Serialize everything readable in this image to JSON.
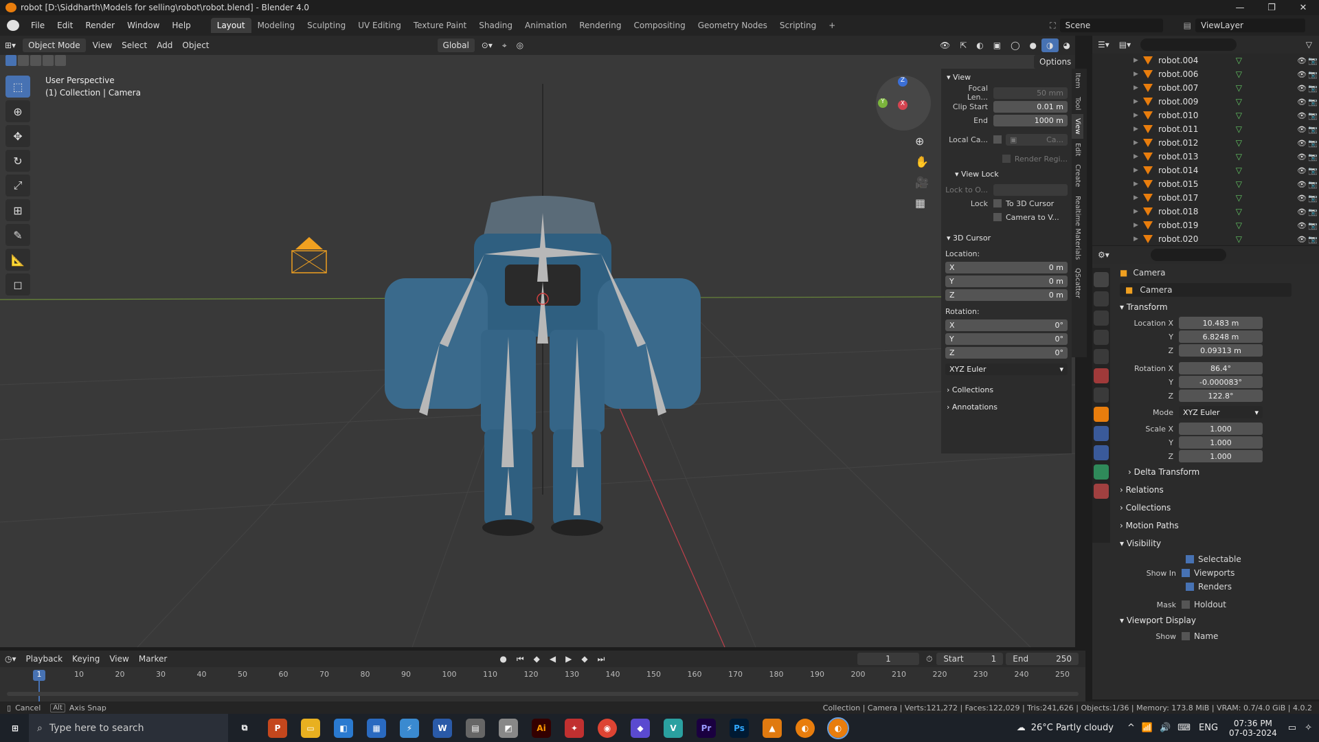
{
  "titlebar": {
    "title": "robot [D:\\Siddharth\\Models for selling\\robot\\robot.blend] - Blender 4.0"
  },
  "menubar": {
    "menus": [
      "File",
      "Edit",
      "Render",
      "Window",
      "Help"
    ],
    "workspaces": [
      "Layout",
      "Modeling",
      "Sculpting",
      "UV Editing",
      "Texture Paint",
      "Shading",
      "Animation",
      "Rendering",
      "Compositing",
      "Geometry Nodes",
      "Scripting"
    ],
    "scene_label": "Scene",
    "viewlayer_label": "ViewLayer"
  },
  "viewport_header": {
    "mode": "Object Mode",
    "menus": [
      "View",
      "Select",
      "Add",
      "Object"
    ],
    "transform_orientation": "Global",
    "options_label": "Options"
  },
  "viewport": {
    "perspective_label": "User Perspective",
    "collection_label": "(1) Collection | Camera",
    "gizmo_axes": [
      "Z",
      "Y",
      "X"
    ]
  },
  "npanel": {
    "tabs": [
      "Item",
      "Tool",
      "View",
      "Edit",
      "Create",
      "Realtime Materials",
      "QScatter"
    ],
    "view_section": "View",
    "focal_length_label": "Focal Len...",
    "focal_length": "50 mm",
    "clip_start_label": "Clip Start",
    "clip_start": "0.01 m",
    "clip_end_label": "End",
    "clip_end": "1000 m",
    "local_camera_label": "Local Ca...",
    "local_camera_value": "Ca...",
    "render_region_label": "Render Regi...",
    "view_lock_section": "View Lock",
    "lock_to_object_label": "Lock to O...",
    "lock_label": "Lock",
    "to_3d_cursor": "To 3D Cursor",
    "camera_to_view": "Camera to V...",
    "cursor_section": "3D Cursor",
    "location_label": "Location:",
    "location": [
      {
        "axis": "X",
        "value": "0 m"
      },
      {
        "axis": "Y",
        "value": "0 m"
      },
      {
        "axis": "Z",
        "value": "0 m"
      }
    ],
    "rotation_label": "Rotation:",
    "rotation": [
      {
        "axis": "X",
        "value": "0°"
      },
      {
        "axis": "Y",
        "value": "0°"
      },
      {
        "axis": "Z",
        "value": "0°"
      }
    ],
    "rotation_mode": "XYZ Euler",
    "collections_section": "Collections",
    "annotations_section": "Annotations"
  },
  "outliner": {
    "items": [
      "robot.004",
      "robot.006",
      "robot.007",
      "robot.009",
      "robot.010",
      "robot.011",
      "robot.012",
      "robot.013",
      "robot.014",
      "robot.015",
      "robot.017",
      "robot.018",
      "robot.019",
      "robot.020"
    ]
  },
  "properties": {
    "object_name_header": "Camera",
    "object_name_field": "Camera",
    "transform_section": "Transform",
    "location_x_label": "Location X",
    "location": [
      "10.483 m",
      "6.8248 m",
      "0.09313 m"
    ],
    "rotation_x_label": "Rotation X",
    "rotation": [
      "86.4°",
      "-0.000083°",
      "122.8°"
    ],
    "mode_label": "Mode",
    "mode": "XYZ Euler",
    "scale_x_label": "Scale X",
    "scale": [
      "1.000",
      "1.000",
      "1.000"
    ],
    "y_label": "Y",
    "z_label": "Z",
    "delta_transform": "Delta Transform",
    "relations": "Relations",
    "collections": "Collections",
    "motion_paths": "Motion Paths",
    "visibility": "Visibility",
    "selectable": "Selectable",
    "show_in_label": "Show In",
    "viewports": "Viewports",
    "renders": "Renders",
    "mask_label": "Mask",
    "holdout": "Holdout",
    "viewport_display": "Viewport Display",
    "show_label": "Show",
    "name_label": "Name"
  },
  "timeline": {
    "menus": [
      "Playback",
      "Keying",
      "View",
      "Marker"
    ],
    "current_frame": "1",
    "start_label": "Start",
    "start": "1",
    "end_label": "End",
    "end": "250",
    "ticks": [
      "10",
      "20",
      "30",
      "40",
      "50",
      "60",
      "70",
      "80",
      "90",
      "100",
      "110",
      "120",
      "130",
      "140",
      "150",
      "160",
      "170",
      "180",
      "190",
      "200",
      "210",
      "220",
      "230",
      "240",
      "250"
    ],
    "playhead": "1"
  },
  "statusbar": {
    "cancel": "Cancel",
    "alt_key": "Alt",
    "axis_snap": "Axis Snap",
    "stats": "Collection | Camera | Verts:121,272 | Faces:122,029 | Tris:241,626 | Objects:1/36 | Memory: 173.8 MiB | VRAM: 0.7/4.0 GiB | 4.0.2"
  },
  "taskbar": {
    "search_placeholder": "Type here to search",
    "weather": "26°C  Partly cloudy",
    "lang": "ENG",
    "time": "07:36 PM",
    "date": "07-03-2024"
  }
}
